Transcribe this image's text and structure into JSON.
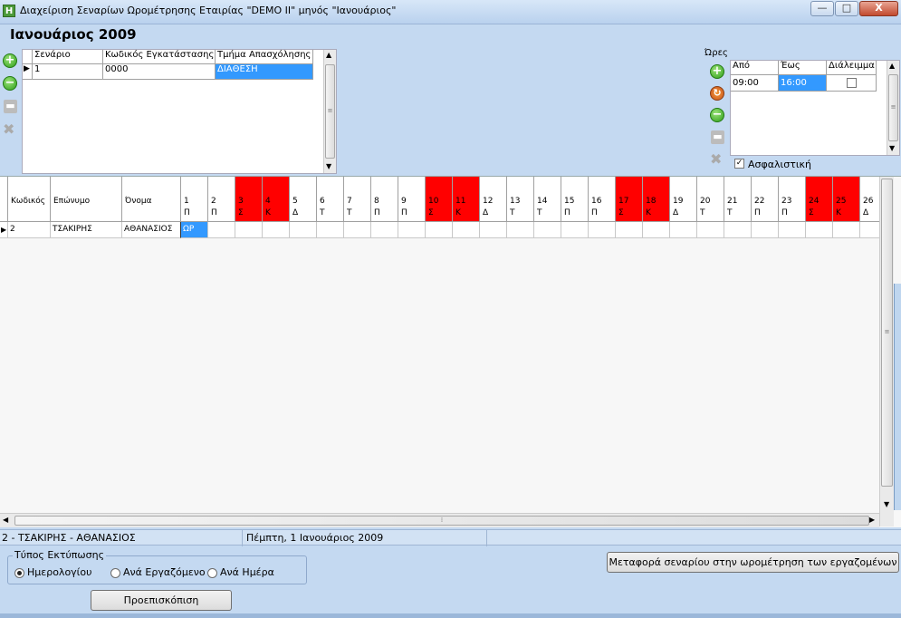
{
  "window": {
    "title": "Διαχείριση Σεναρίων Ωρομέτρησης Εταιρίας \"DEMO II\" μηνός \"Ιανουάριος\"",
    "app_icon": "H",
    "minimize": "—",
    "maximize": "□",
    "close": "X"
  },
  "month_title": "Ιανουάριος 2009",
  "scenario_grid": {
    "headers": [
      "Σενάριο",
      "Κωδικός Εγκατάστασης",
      "Τμήμα Απασχόλησης"
    ],
    "row": {
      "scenario": "1",
      "install_code": "0000",
      "department": "ΔΙΑΘΕΣΗ"
    }
  },
  "hours": {
    "label": "Ώρες",
    "headers": [
      "Από",
      "Έως",
      "Διάλειμμα"
    ],
    "row": {
      "from": "09:00",
      "to": "16:00"
    },
    "insured_label": "Ασφαλιστική",
    "insured_checked": true
  },
  "employee_grid": {
    "headers": {
      "code": "Κωδικός",
      "surname": "Επώνυμο",
      "name": "Όνομα"
    },
    "days": [
      {
        "n": "1",
        "d": "Π",
        "red": false
      },
      {
        "n": "2",
        "d": "Π",
        "red": false
      },
      {
        "n": "3",
        "d": "Σ",
        "red": true
      },
      {
        "n": "4",
        "d": "Κ",
        "red": true
      },
      {
        "n": "5",
        "d": "Δ",
        "red": false
      },
      {
        "n": "6",
        "d": "Τ",
        "red": false
      },
      {
        "n": "7",
        "d": "Τ",
        "red": false
      },
      {
        "n": "8",
        "d": "Π",
        "red": false
      },
      {
        "n": "9",
        "d": "Π",
        "red": false
      },
      {
        "n": "10",
        "d": "Σ",
        "red": true
      },
      {
        "n": "11",
        "d": "Κ",
        "red": true
      },
      {
        "n": "12",
        "d": "Δ",
        "red": false
      },
      {
        "n": "13",
        "d": "Τ",
        "red": false
      },
      {
        "n": "14",
        "d": "Τ",
        "red": false
      },
      {
        "n": "15",
        "d": "Π",
        "red": false
      },
      {
        "n": "16",
        "d": "Π",
        "red": false
      },
      {
        "n": "17",
        "d": "Σ",
        "red": true
      },
      {
        "n": "18",
        "d": "Κ",
        "red": true
      },
      {
        "n": "19",
        "d": "Δ",
        "red": false
      },
      {
        "n": "20",
        "d": "Τ",
        "red": false
      },
      {
        "n": "21",
        "d": "Τ",
        "red": false
      },
      {
        "n": "22",
        "d": "Π",
        "red": false
      },
      {
        "n": "23",
        "d": "Π",
        "red": false
      },
      {
        "n": "24",
        "d": "Σ",
        "red": true
      },
      {
        "n": "25",
        "d": "Κ",
        "red": true
      },
      {
        "n": "26",
        "d": "Δ",
        "red": false
      }
    ],
    "row": {
      "code": "2",
      "surname": "ΤΣΑΚΙΡΗΣ",
      "name": "ΑΘΑΝΑΣΙΟΣ",
      "day1": "ΩΡ"
    }
  },
  "status": {
    "employee": "2 - ΤΣΑΚΙΡΗΣ - ΑΘΑΝΑΣΙΟΣ",
    "date": "Πέμπτη, 1 Ιανουάριος 2009"
  },
  "print": {
    "group_label": "Τύπος Εκτύπωσης",
    "options": [
      "Ημερολογίου",
      "Ανά Εργαζόμενο",
      "Ανά Ημέρα"
    ],
    "selected": "Ημερολογίου",
    "preview_button": "Προεπισκόπιση"
  },
  "transfer_button": "Μεταφορά σεναρίου στην ωρομέτρηση των εργαζομένων",
  "icons": {
    "add": "plus-circle-icon",
    "remove": "minus-circle-icon",
    "save": "disk-icon",
    "delete": "cross-icon",
    "refresh": "refresh-icon"
  },
  "colors": {
    "weekend": "#ff0000",
    "selection": "#3399ff",
    "form_bg": "#c4d9f1"
  }
}
